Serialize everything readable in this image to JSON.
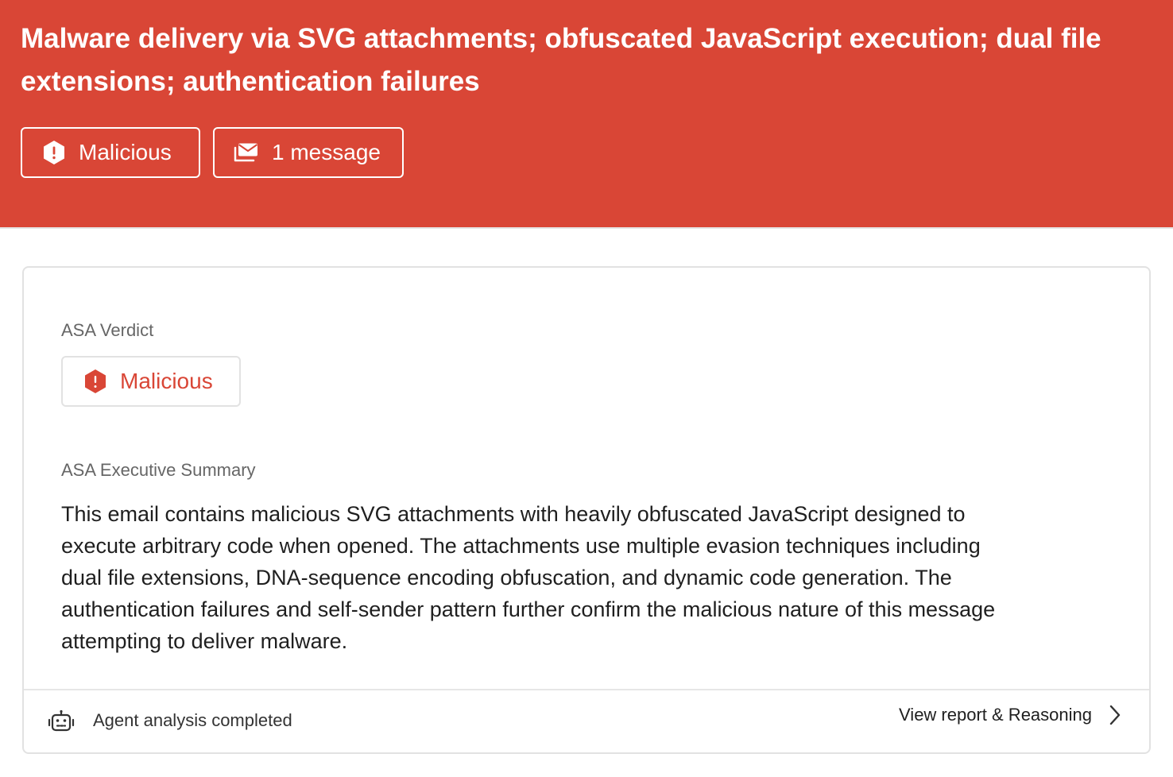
{
  "header": {
    "title": "Malware delivery via SVG attachments; obfuscated JavaScript execution; dual file extensions; authentication failures",
    "verdict_chip": {
      "label": "Malicious",
      "icon": "alert-hexagon-icon"
    },
    "messages_chip": {
      "label": "1 message",
      "icon": "envelope-stack-icon"
    },
    "background_color": "#d94636"
  },
  "card": {
    "verdict_label": "ASA Verdict",
    "verdict_badge": {
      "label": "Malicious",
      "icon": "alert-hexagon-icon",
      "color": "#d94636"
    },
    "summary_label": "ASA Executive Summary",
    "summary_text": "This email contains malicious SVG attachments with heavily obfuscated JavaScript designed to execute arbitrary code when opened. The attachments use multiple evasion techniques including dual file extensions, DNA-sequence encoding obfuscation, and dynamic code generation. The authentication failures and self-sender pattern further confirm the malicious nature of this message attempting to deliver malware.",
    "footer": {
      "status_icon": "robot-icon",
      "status_text": "Agent analysis completed",
      "link_label": "View report & Reasoning",
      "link_icon": "chevron-right-icon"
    }
  }
}
